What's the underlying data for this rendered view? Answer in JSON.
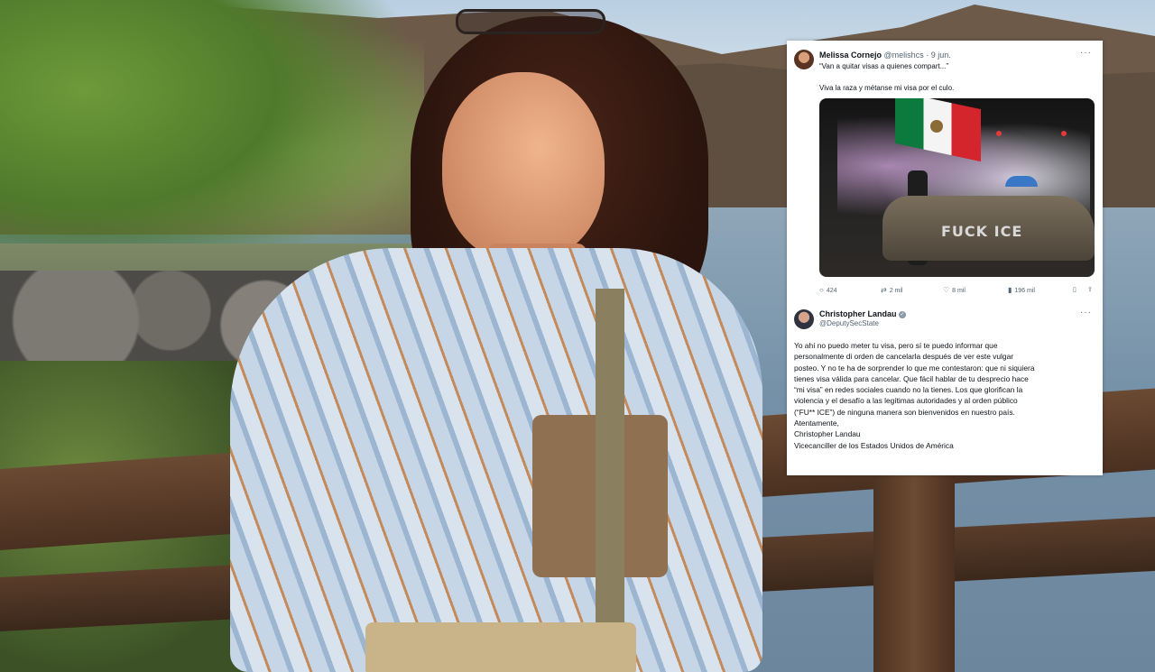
{
  "tweet1": {
    "name": "Melissa Cornejo",
    "handle": "@melishcs",
    "date": "· 9 jun.",
    "quote": "“Van a quitar visas a quienes compart...”",
    "text": "Viva la raza y métanse mi visa por el culo.",
    "media_text": "FUCK ICE",
    "replies": "424",
    "reposts": "2 mil",
    "likes": "8 mil",
    "views": "196 mil",
    "icons": [
      "reply-icon",
      "repost-icon",
      "like-icon",
      "views-icon",
      "bookmark-icon",
      "share-icon"
    ]
  },
  "tweet2": {
    "name": "Christopher Landau",
    "handle": "@DeputySecState",
    "lines": [
      "Yo ahí no puedo meter tu visa, pero sí te puedo informar que",
      "personalmente di orden de cancelarla después de ver este vulgar",
      "posteo. Y no te ha de sorprender lo que me contestaron: que ni siquiera",
      "tienes visa válida para cancelar. Que fácil hablar de tu desprecio hace",
      "“mi visa” en redes sociales cuando no la tienes. Los que glorifican la",
      "violencia y el desafío a las legítimas autoridades y al orden público",
      "(“FU** ICE”) de ninguna manera son bienvenidos en nuestro país.",
      "Atentamente,",
      "Christopher Landau",
      "Vicecanciller de los Estados Unidos de América"
    ]
  },
  "colors": {
    "card_bg": "#ffffff",
    "text": "#0f1419",
    "secondary_text": "#536471"
  }
}
